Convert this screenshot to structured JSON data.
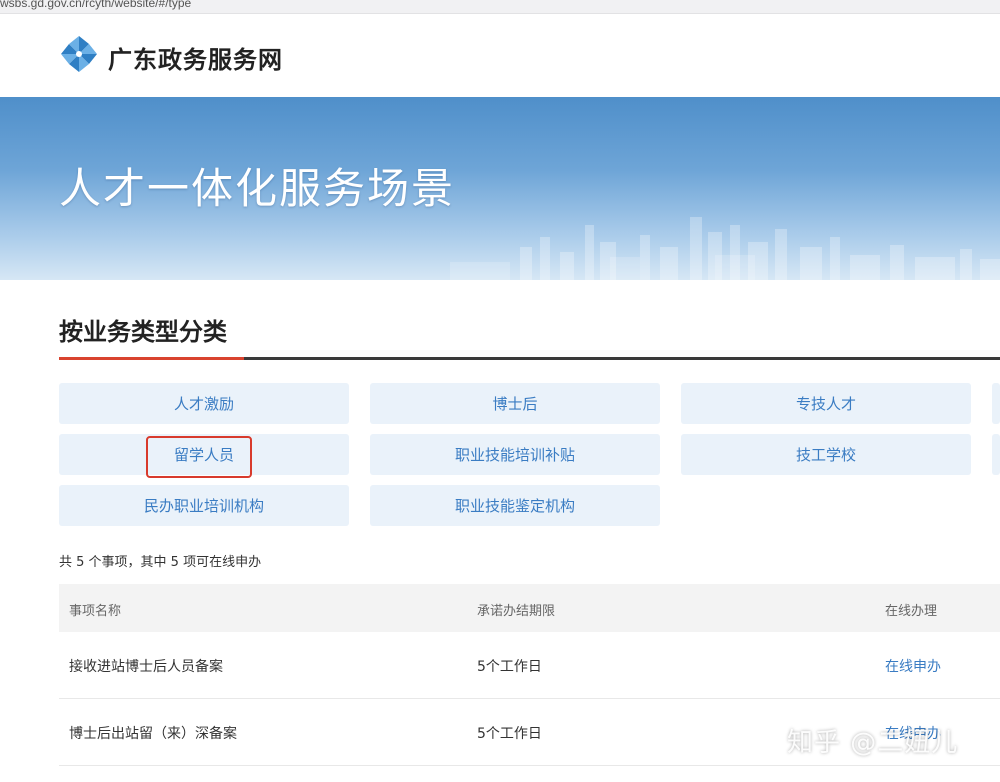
{
  "browser": {
    "url": "wsbs.gd.gov.cn/rcyth/website/#/type"
  },
  "header": {
    "site_name": "广东政务服务网",
    "logo": "pinwheel-logo-icon"
  },
  "banner": {
    "title": "人才一体化服务场景"
  },
  "section": {
    "title": "按业务类型分类"
  },
  "categories": [
    "人才激励",
    "博士后",
    "专技人才",
    "留学人员",
    "职业技能培训补贴",
    "技工学校",
    "民办职业培训机构",
    "职业技能鉴定机构"
  ],
  "summary": {
    "text": "共 5 个事项，其中 5 项可在线申办"
  },
  "table": {
    "headers": [
      "事项名称",
      "承诺办结期限",
      "在线办理"
    ],
    "rows": [
      {
        "name": "接收进站博士后人员备案",
        "deadline": "5个工作日",
        "action": "在线申办"
      },
      {
        "name": "博士后出站留（来）深备案",
        "deadline": "5个工作日",
        "action": "在线申办"
      }
    ]
  },
  "watermark": {
    "text": "知乎 @二妞儿"
  },
  "colors": {
    "accent_blue": "#3a7cc3",
    "highlight_red": "#d83a2c",
    "button_bg": "#eaf2fa"
  }
}
